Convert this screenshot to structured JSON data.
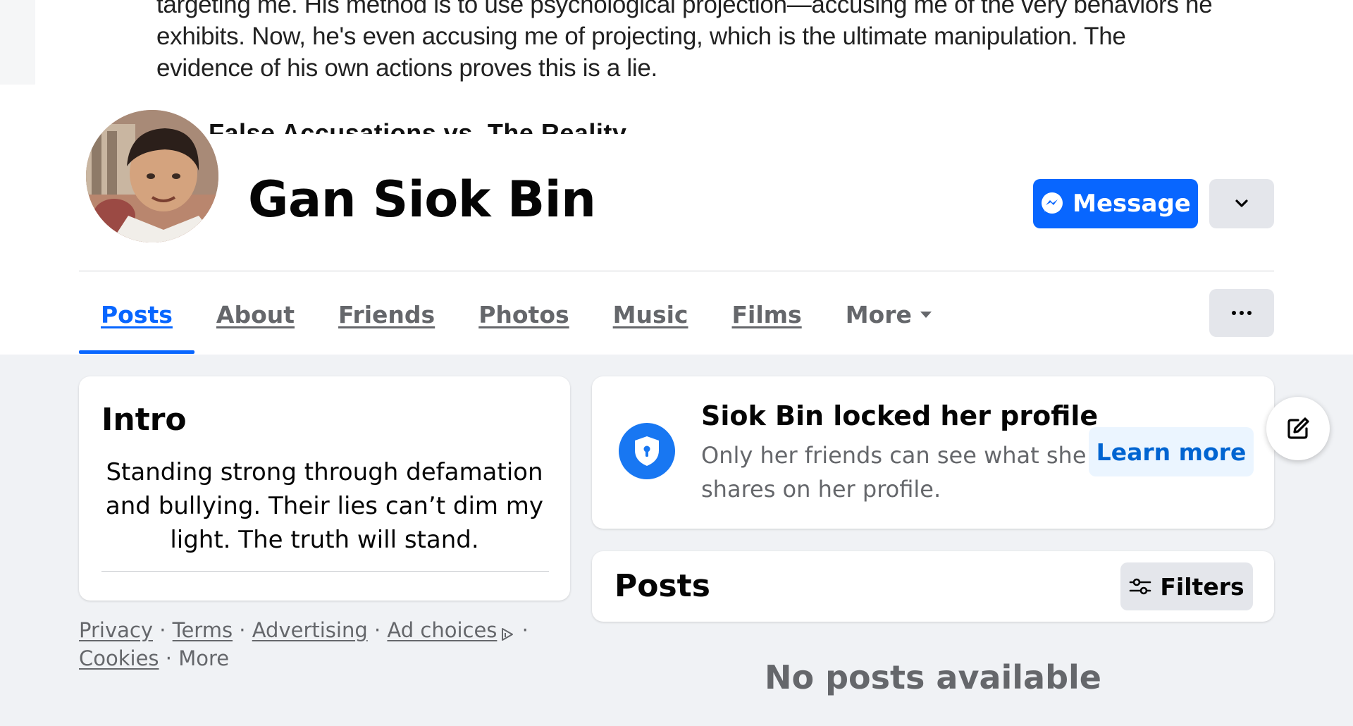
{
  "cover": {
    "text": "targeting me. His method is to use psychological projection—accusing me of the very behaviors he exhibits. Now, he's even accusing me of projecting, which is the ultimate manipulation. The evidence of his own actions proves this is a lie.",
    "subheading": "False Accusations vs. The Reality"
  },
  "profile": {
    "name": "Gan Siok Bin",
    "avatar": "profile-photo"
  },
  "actions": {
    "message_label": "Message",
    "message_icon": "messenger-icon",
    "dropdown_icon": "chevron-down-icon",
    "ellipsis_icon": "ellipsis-icon"
  },
  "tabs": [
    {
      "label": "Posts",
      "active": true
    },
    {
      "label": "About"
    },
    {
      "label": "Friends"
    },
    {
      "label": "Photos"
    },
    {
      "label": "Music"
    },
    {
      "label": "Films"
    },
    {
      "label": "More"
    }
  ],
  "intro": {
    "title": "Intro",
    "bio": "Standing strong through defamation and bullying. Their lies can’t dim my light. The truth will stand."
  },
  "footer": {
    "links": [
      "Privacy",
      "Terms",
      "Advertising",
      "Ad choices",
      "Cookies"
    ],
    "more": "More",
    "separator": "·"
  },
  "locked": {
    "title": "Siok Bin locked her profile",
    "description": "Only her friends can see what she shares on her profile.",
    "learn_more_label": "Learn more",
    "icon": "shield-lock-icon"
  },
  "posts": {
    "title": "Posts",
    "filters_label": "Filters",
    "empty_message": "No posts available"
  },
  "colors": {
    "accent": "#0866ff",
    "page_background": "#f0f2f5",
    "secondary_text": "#65676b",
    "button_gray": "#e4e6eb",
    "learn_more_bg": "#ebf5ff"
  }
}
